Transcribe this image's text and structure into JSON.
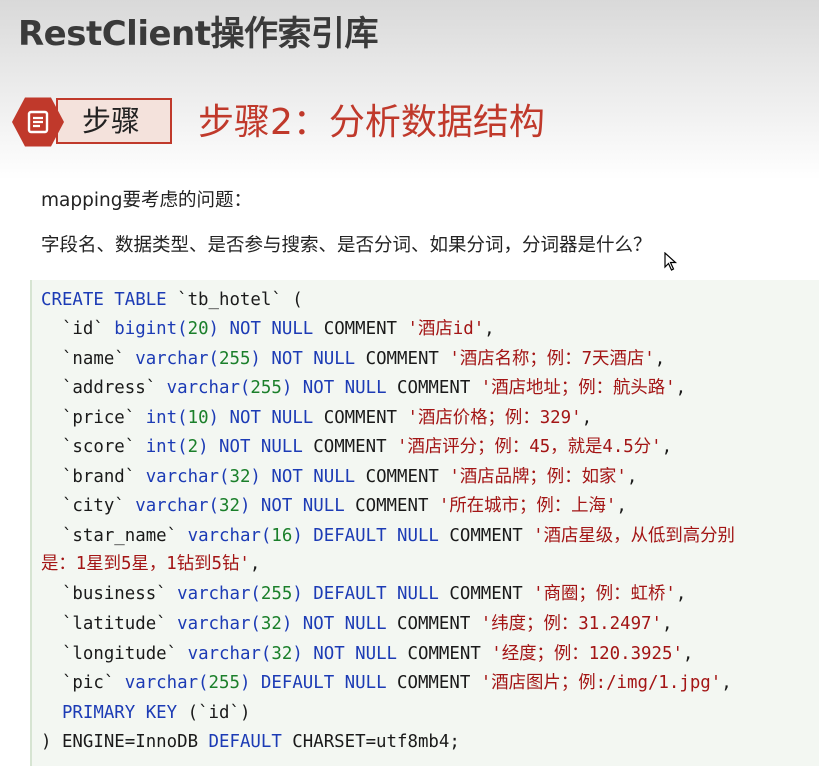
{
  "slide_title": "RestClient操作索引库",
  "step_badge": {
    "label": "步骤",
    "icon": "document-icon"
  },
  "step_heading": "步骤2：分析数据结构",
  "intro": {
    "line1": "mapping要考虑的问题：",
    "line2": "字段名、数据类型、是否参与搜索、是否分词、如果分词，分词器是什么？"
  },
  "code": {
    "create": {
      "kw1": "CREATE TABLE",
      "name": " `tb_hotel` ("
    },
    "id": {
      "col": "  `id` ",
      "type": "bigint(",
      "len": "20",
      "close": ") ",
      "constraint": "NOT NULL",
      "cm": " COMMENT ",
      "str": "'酒店id'",
      "end": ","
    },
    "name": {
      "col": "  `name` ",
      "type": "varchar(",
      "len": "255",
      "close": ") ",
      "constraint": "NOT NULL",
      "cm": " COMMENT ",
      "str": "'酒店名称；例：7天酒店'",
      "end": ","
    },
    "address": {
      "col": "  `address` ",
      "type": "varchar(",
      "len": "255",
      "close": ") ",
      "constraint": "NOT NULL",
      "cm": " COMMENT ",
      "str": "'酒店地址；例：航头路'",
      "end": ","
    },
    "price": {
      "col": "  `price` ",
      "type": "int(",
      "len": "10",
      "close": ") ",
      "constraint": "NOT NULL",
      "cm": " COMMENT ",
      "str": "'酒店价格；例：329'",
      "end": ","
    },
    "score": {
      "col": "  `score` ",
      "type": "int(",
      "len": "2",
      "close": ") ",
      "constraint": "NOT NULL",
      "cm": " COMMENT ",
      "str": "'酒店评分；例：45，就是4.5分'",
      "end": ","
    },
    "brand": {
      "col": "  `brand` ",
      "type": "varchar(",
      "len": "32",
      "close": ") ",
      "constraint": "NOT NULL",
      "cm": " COMMENT ",
      "str": "'酒店品牌；例：如家'",
      "end": ","
    },
    "city": {
      "col": "  `city` ",
      "type": "varchar(",
      "len": "32",
      "close": ") ",
      "constraint": "NOT NULL",
      "cm": " COMMENT ",
      "str": "'所在城市；例：上海'",
      "end": ","
    },
    "star_name": {
      "col": "  `star_name` ",
      "type": "varchar(",
      "len": "16",
      "close": ") ",
      "constraint": "DEFAULT NULL",
      "cm": " COMMENT ",
      "str": "'酒店星级，从低到高分别",
      "str_cont": "是：1星到5星，1钻到5钻'",
      "end": ","
    },
    "business": {
      "col": "  `business` ",
      "type": "varchar(",
      "len": "255",
      "close": ") ",
      "constraint": "DEFAULT NULL",
      "cm": " COMMENT ",
      "str": "'商圈；例：虹桥'",
      "end": ","
    },
    "latitude": {
      "col": "  `latitude` ",
      "type": "varchar(",
      "len": "32",
      "close": ") ",
      "constraint": "NOT NULL",
      "cm": " COMMENT ",
      "str": "'纬度；例：31.2497'",
      "end": ","
    },
    "longitude": {
      "col": "  `longitude` ",
      "type": "varchar(",
      "len": "32",
      "close": ") ",
      "constraint": "NOT NULL",
      "cm": " COMMENT ",
      "str": "'经度；例：120.3925'",
      "end": ","
    },
    "pic": {
      "col": "  `pic` ",
      "type": "varchar(",
      "len": "255",
      "close": ") ",
      "constraint": "DEFAULT NULL",
      "cm": " COMMENT ",
      "str": "'酒店图片；例:/img/1.jpg'",
      "end": ","
    },
    "pk": {
      "indent": "  ",
      "kw": "PRIMARY KEY",
      "rest": " (`id`)"
    },
    "engine": {
      "lead": ") ENGINE=InnoDB ",
      "kw": "DEFAULT",
      "rest": " CHARSET=utf8mb4;"
    }
  },
  "colors": {
    "accent": "#c0392b",
    "keyword": "#1c3bb5",
    "number": "#1a7f2a",
    "string": "#a31515",
    "code_bg": "#f3f7f2"
  }
}
